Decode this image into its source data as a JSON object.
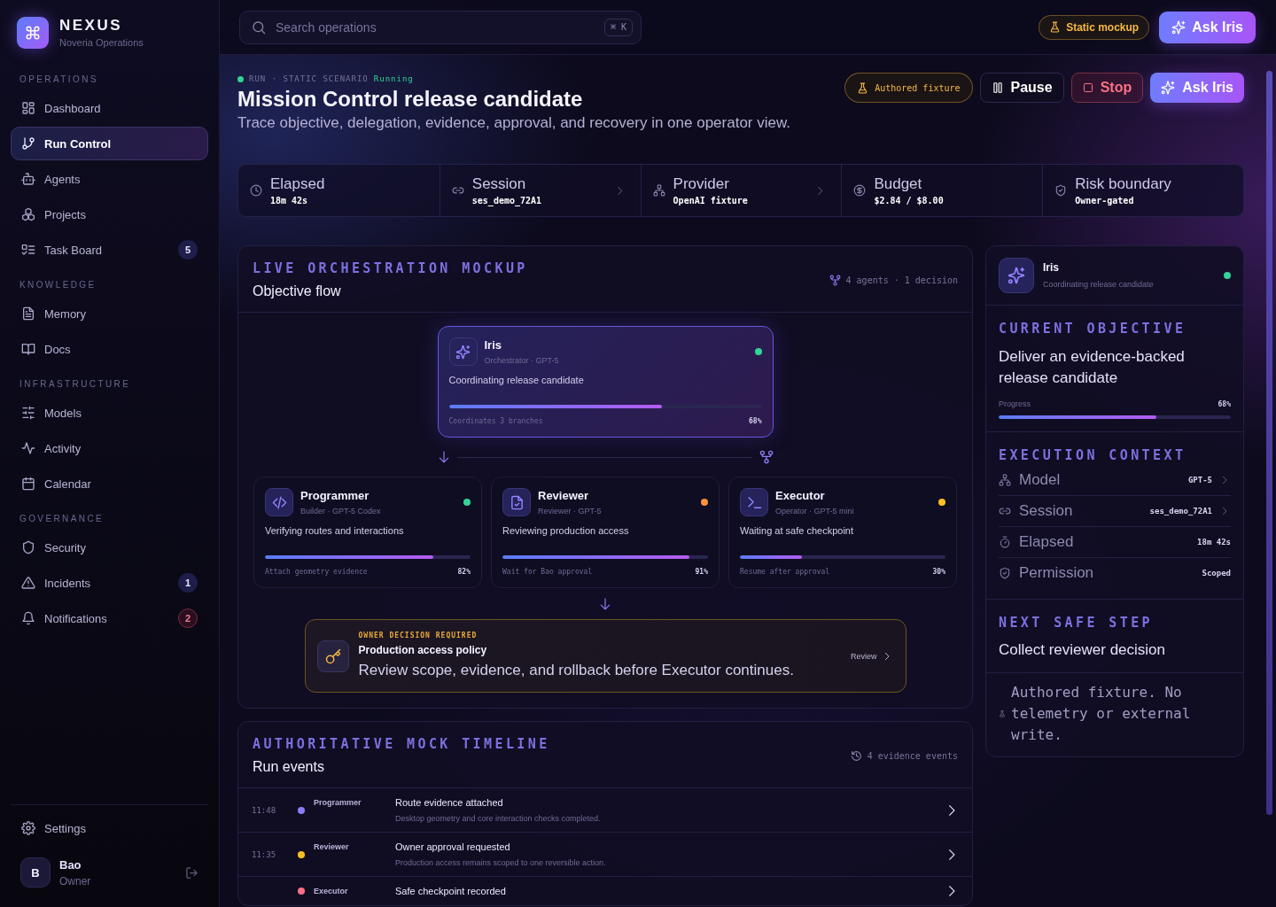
{
  "sidebar": {
    "brand": {
      "name": "NEXUS",
      "subtitle": "Noveria Operations"
    },
    "sections": [
      {
        "title": "OPERATIONS",
        "items": [
          {
            "label": "Dashboard",
            "selected": false
          },
          {
            "label": "Run Control",
            "selected": true
          },
          {
            "label": "Agents",
            "selected": false
          },
          {
            "label": "Projects",
            "selected": false
          },
          {
            "label": "Task Board",
            "selected": false,
            "badge": {
              "count": "5",
              "urgent": false
            }
          }
        ]
      },
      {
        "title": "KNOWLEDGE",
        "items": [
          {
            "label": "Memory",
            "selected": false
          },
          {
            "label": "Docs",
            "selected": false
          }
        ]
      },
      {
        "title": "INFRASTRUCTURE",
        "items": [
          {
            "label": "Models",
            "selected": false
          },
          {
            "label": "Activity",
            "selected": false
          },
          {
            "label": "Calendar",
            "selected": false
          }
        ]
      },
      {
        "title": "GOVERNANCE",
        "items": [
          {
            "label": "Security",
            "selected": false
          },
          {
            "label": "Incidents",
            "selected": false,
            "badge": {
              "count": "1",
              "urgent": false
            }
          },
          {
            "label": "Notifications",
            "selected": false,
            "badge": {
              "count": "2",
              "urgent": true
            }
          }
        ]
      }
    ],
    "settings": "Settings",
    "user": {
      "initial": "B",
      "name": "Bao",
      "role": "Owner"
    }
  },
  "topbar": {
    "search": {
      "placeholder": "Search operations",
      "shortcut": "⌘ K"
    },
    "mode": "Static mockup",
    "ask_button": "Ask Iris"
  },
  "header": {
    "eyebrow": "RUN · STATIC SCENARIO",
    "status": {
      "label": "Running",
      "color": "#34d399"
    },
    "title": "Mission Control release candidate",
    "subtitle": "Trace objective, delegation, evidence, approval, and recovery in one operator view.",
    "actions": [
      {
        "kind": "fixture",
        "label": "Authored fixture"
      },
      {
        "kind": "pause",
        "label": "Pause"
      },
      {
        "kind": "stop",
        "label": "Stop"
      },
      {
        "kind": "primary",
        "label": "Ask Iris"
      }
    ]
  },
  "stats": [
    {
      "label": "Elapsed",
      "value": "18m 42s",
      "has_detail": false
    },
    {
      "label": "Session",
      "value": "ses_demo_72A1",
      "has_detail": true
    },
    {
      "label": "Provider",
      "value": "OpenAI fixture",
      "has_detail": true
    },
    {
      "label": "Budget",
      "value": "$2.84 / $8.00",
      "has_detail": false
    },
    {
      "label": "Risk boundary",
      "value": "Owner-gated",
      "has_detail": false
    }
  ],
  "flow": {
    "eyebrow": "LIVE ORCHESTRATION MOCKUP",
    "title": "Objective flow",
    "meta": "4 agents · 1 decision",
    "lead": {
      "name": "Iris",
      "role": "Orchestrator · GPT-5",
      "color": "#34d399",
      "activity": "Coordinating release candidate",
      "level": 0.68,
      "note": "Coordinates 3 branches",
      "percent": "68%"
    },
    "agents": [
      {
        "name": "Programmer",
        "role": "Builder · GPT-5 Codex",
        "color": "#34d399",
        "activity": "Verifying routes and interactions",
        "level": 0.82,
        "note": "Attach geometry evidence",
        "percent": "82%"
      },
      {
        "name": "Reviewer",
        "role": "Reviewer · GPT-5",
        "color": "#fb923c",
        "activity": "Reviewing production access",
        "level": 0.91,
        "note": "Wait for Bao approval",
        "percent": "91%"
      },
      {
        "name": "Executor",
        "role": "Operator · GPT-5 mini",
        "color": "#fbbf24",
        "activity": "Waiting at safe checkpoint",
        "level": 0.3,
        "note": "Resume after approval",
        "percent": "30%"
      }
    ],
    "decision": {
      "eyebrow": "OWNER DECISION REQUIRED",
      "title": "Production access policy",
      "body": "Review scope, evidence, and rollback before Executor continues.",
      "action": "Review"
    }
  },
  "timeline": {
    "eyebrow": "AUTHORITATIVE MOCK TIMELINE",
    "title": "Run events",
    "meta": "4 evidence events",
    "events": [
      {
        "time": "11:48",
        "agent": "Programmer",
        "color": "#8b7cf6",
        "title": "Route evidence attached",
        "detail": "Desktop geometry and core interaction checks completed."
      },
      {
        "time": "11:35",
        "agent": "Reviewer",
        "color": "#fbbf24",
        "title": "Owner approval requested",
        "detail": "Production access remains scoped to one reversible action."
      },
      {
        "agent": "Executor",
        "color": "#fb7185",
        "title": "Safe checkpoint recorded"
      }
    ]
  },
  "iris_panel": {
    "agent": {
      "name": "Iris",
      "activity": "Coordinating release candidate",
      "color": "#34d399"
    },
    "objective": {
      "heading": "CURRENT OBJECTIVE",
      "text": "Deliver an evidence-backed release candidate",
      "progress_label": "Progress",
      "percent": "68%",
      "level": 0.68
    },
    "context": {
      "heading": "EXECUTION CONTEXT",
      "rows": [
        {
          "label": "Model",
          "value": "GPT-5",
          "has_detail": true
        },
        {
          "label": "Session",
          "value": "ses_demo_72A1",
          "has_detail": true
        },
        {
          "label": "Elapsed",
          "value": "18m 42s",
          "has_detail": false
        },
        {
          "label": "Permission",
          "value": "Scoped",
          "has_detail": false
        }
      ]
    },
    "next_step": {
      "heading": "NEXT SAFE STEP",
      "text": "Collect reviewer decision"
    },
    "note": "Authored fixture. No telemetry or external write."
  }
}
